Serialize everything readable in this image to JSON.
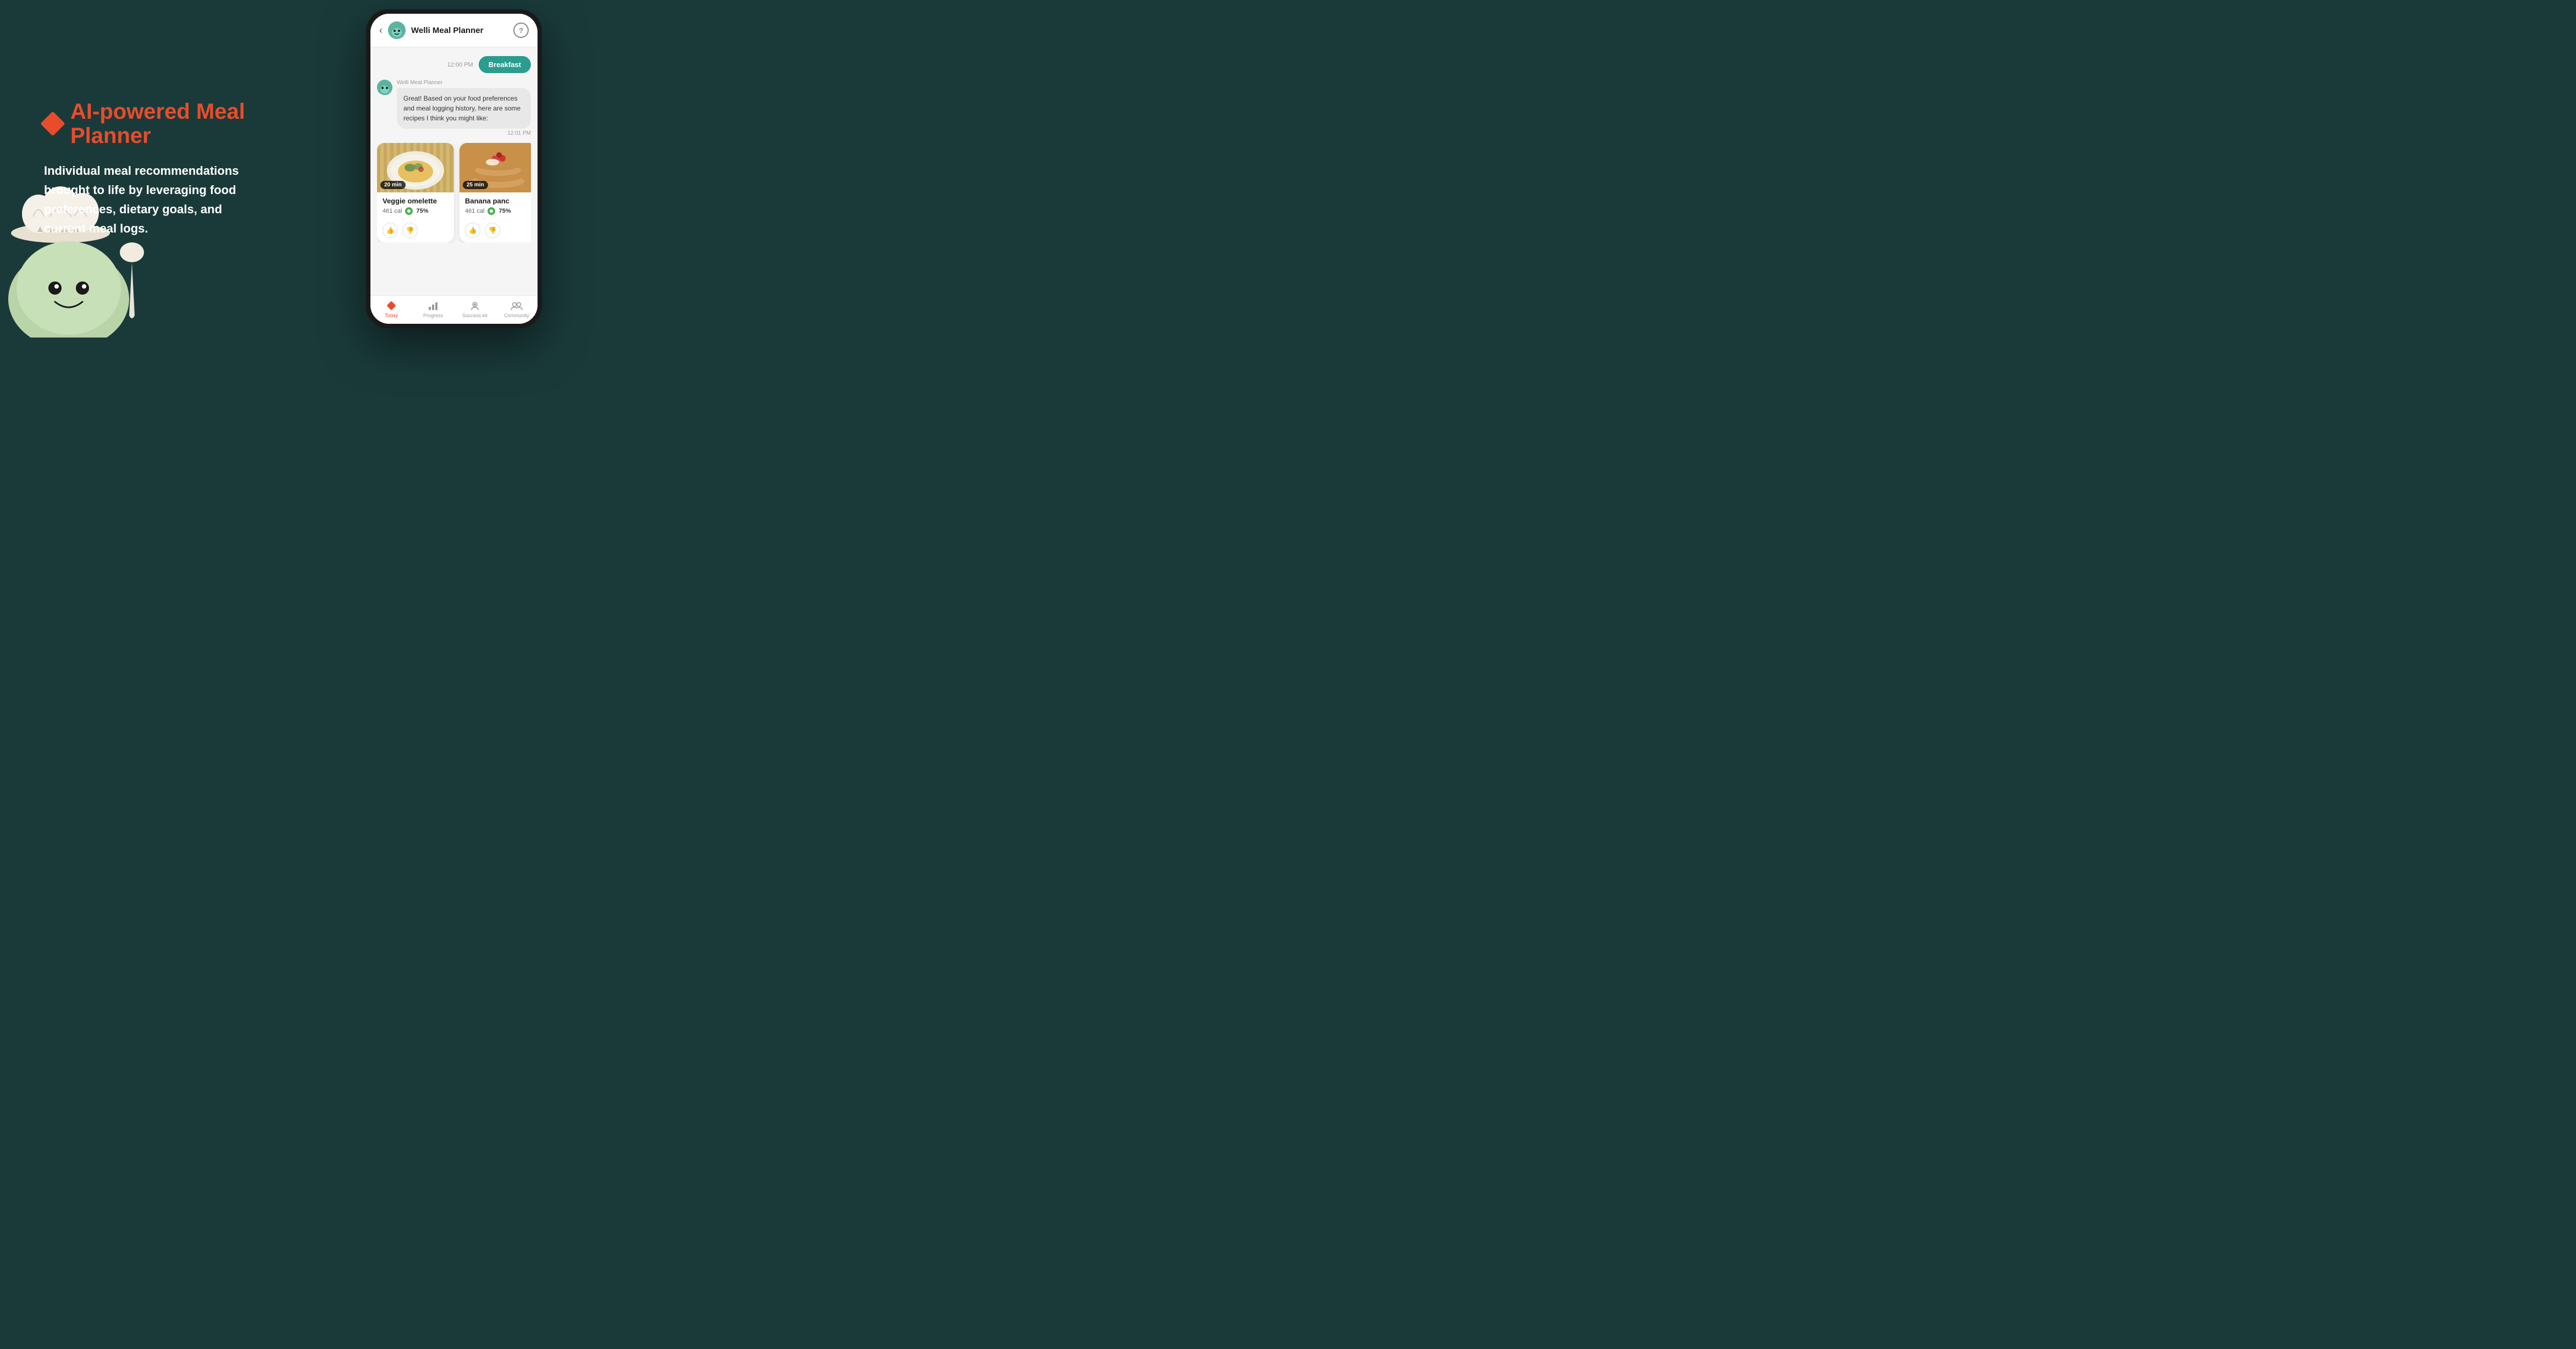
{
  "background_color": "#1a3a3a",
  "left": {
    "headline": "AI-powered Meal Planner",
    "description": "Individual meal recommendations brought to life by leveraging food preferences, dietary goals, and current meal logs."
  },
  "phone": {
    "header": {
      "back_label": "‹",
      "app_name": "Welli Meal Planner",
      "help_label": "?"
    },
    "chat": {
      "time_label": "12:00 PM",
      "breakfast_tag": "Breakfast",
      "bot_name": "Welli Meal Planner",
      "bot_message": "Great! Based on your food preferences and meal logging history, here are some recipes I think you might like:",
      "bot_time": "12:01 PM"
    },
    "recipes": [
      {
        "name": "Veggie omelette",
        "calories": "461 cal",
        "match": "75%",
        "time": "20 min",
        "img_type": "omelette"
      },
      {
        "name": "Banana panc",
        "calories": "461 cal",
        "match": "75%",
        "time": "25 min",
        "img_type": "pancake"
      }
    ],
    "nav": [
      {
        "label": "Today",
        "active": true,
        "icon": "diamond"
      },
      {
        "label": "Progress",
        "active": false,
        "icon": "bar-chart"
      },
      {
        "label": "Success kit",
        "active": false,
        "icon": "person-circle"
      },
      {
        "label": "Community",
        "active": false,
        "icon": "people"
      }
    ]
  }
}
